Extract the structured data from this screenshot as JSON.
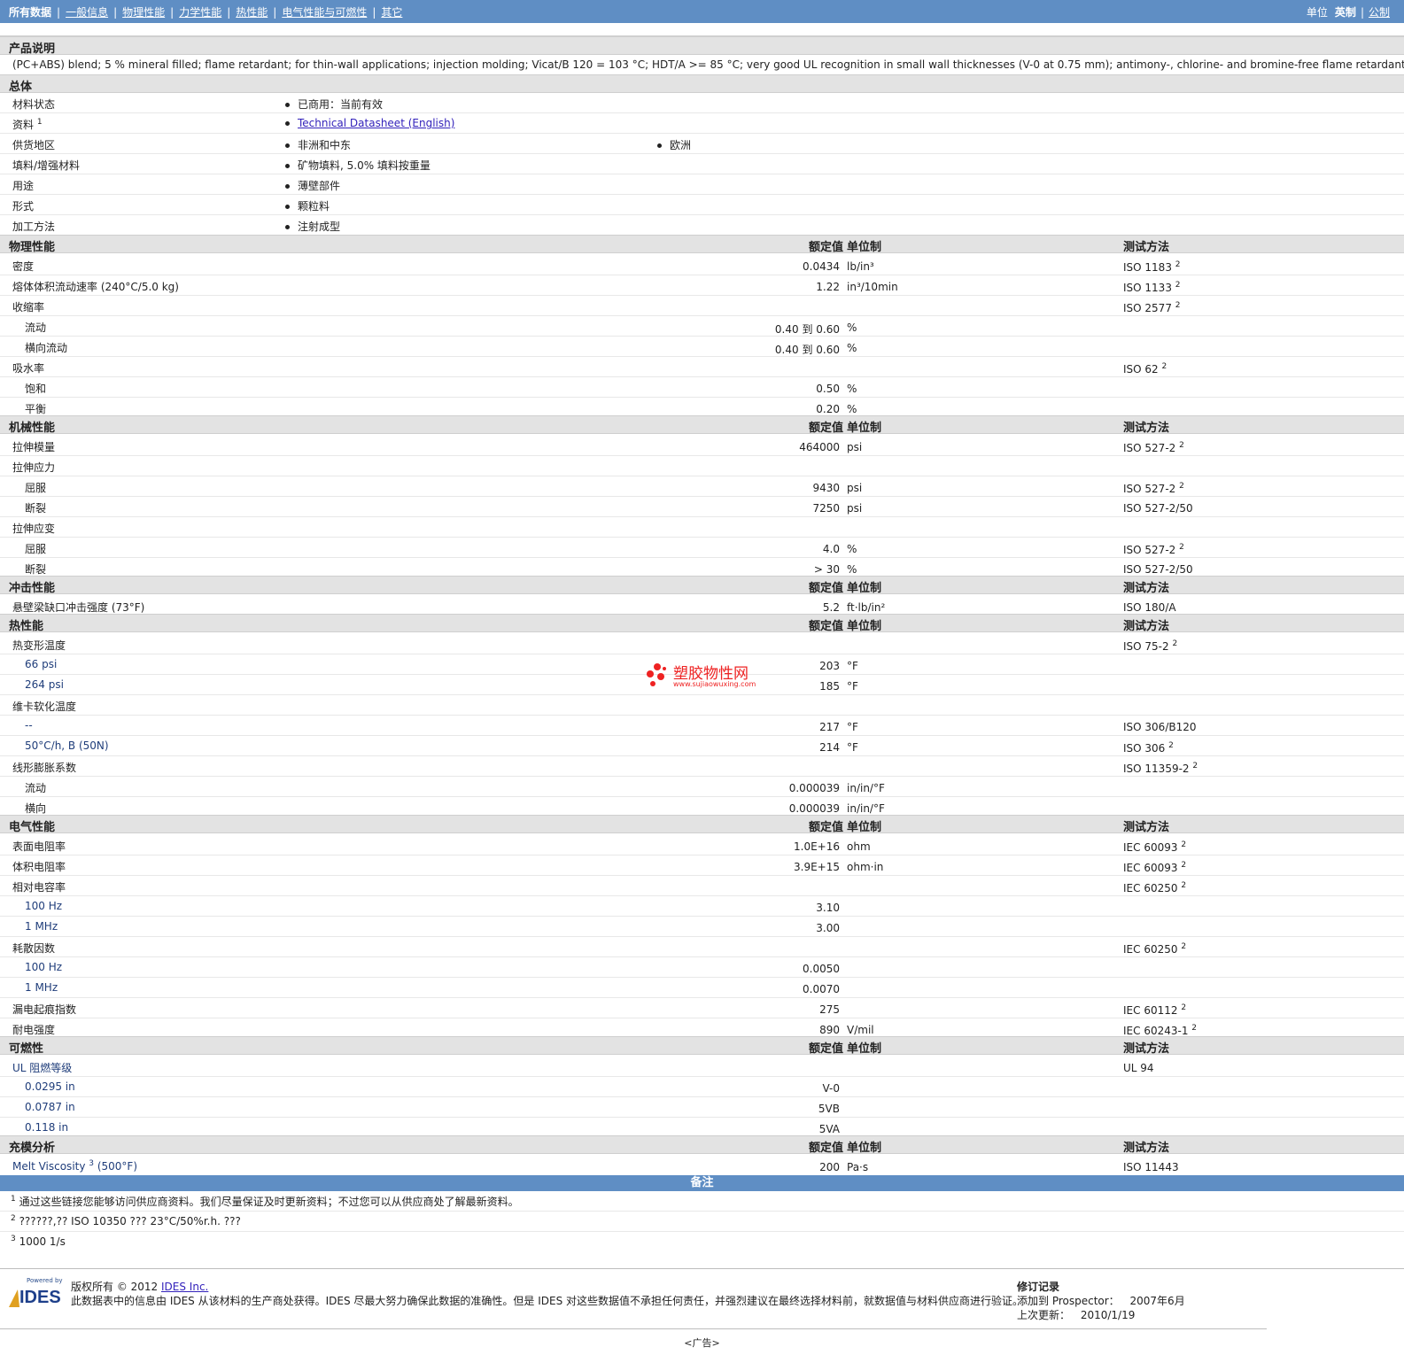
{
  "nav": {
    "items": [
      "所有数据",
      "一般信息",
      "物理性能",
      "力学性能",
      "热性能",
      "电气性能与可燃性",
      "其它"
    ],
    "units_label": "单位",
    "unit_english": "英制",
    "unit_metric": "公制"
  },
  "description": {
    "title": "产品说明",
    "text": "(PC+ABS) blend; 5 % mineral filled; flame retardant; for thin-wall applications; injection molding; Vicat/B 120 = 103 °C; HDT/A >= 85 °C; very good UL recognition in small wall thicknesses (V-0 at 0.75 mm); antimony-, chlorine- and bromine-free flame retardant."
  },
  "general": {
    "title": "总体",
    "rows": {
      "status": {
        "label": "材料状态",
        "value": "已商用：当前有效"
      },
      "docs": {
        "label": "资料",
        "sup": "1",
        "value": "Technical Datasheet (English)"
      },
      "region": {
        "label": "供货地区",
        "value1": "非洲和中东",
        "value2": "欧洲"
      },
      "filler": {
        "label": "填料/增强材料",
        "value": "矿物填料, 5.0% 填料按重量"
      },
      "use": {
        "label": "用途",
        "value": "薄壁部件"
      },
      "form": {
        "label": "形式",
        "value": "颗粒料"
      },
      "process": {
        "label": "加工方法",
        "value": "注射成型"
      }
    }
  },
  "headers": {
    "value": "额定值",
    "unit": "单位制",
    "method": "测试方法"
  },
  "physical": {
    "title": "物理性能",
    "rows": [
      {
        "label": "密度",
        "value": "0.0434",
        "unit": "lb/in³",
        "method": "ISO 1183",
        "sup": "2"
      },
      {
        "label": "熔体体积流动速率 (240°C/5.0 kg)",
        "value": "1.22",
        "unit": "in³/10min",
        "method": "ISO 1133",
        "sup": "2"
      },
      {
        "label": "收缩率",
        "value": "",
        "unit": "",
        "method": "ISO 2577",
        "sup": "2"
      },
      {
        "label": "流动",
        "value": "0.40 到  0.60",
        "unit": "%",
        "method": "",
        "sup": ""
      },
      {
        "label": "横向流动",
        "value": "0.40 到  0.60",
        "unit": "%",
        "method": "",
        "sup": ""
      },
      {
        "label": "吸水率",
        "value": "",
        "unit": "",
        "method": "ISO 62",
        "sup": "2"
      },
      {
        "label": "饱和",
        "value": "0.50",
        "unit": "%",
        "method": "",
        "sup": ""
      },
      {
        "label": "平衡",
        "value": "0.20",
        "unit": "%",
        "method": "",
        "sup": ""
      }
    ]
  },
  "mechanical": {
    "title": "机械性能",
    "rows": [
      {
        "label": "拉伸模量",
        "value": "464000",
        "unit": "psi",
        "method": "ISO 527-2",
        "sup": "2"
      },
      {
        "label": "拉伸应力",
        "value": "",
        "unit": "",
        "method": "",
        "sup": ""
      },
      {
        "label": "屈服",
        "value": "9430",
        "unit": "psi",
        "method": "ISO 527-2",
        "sup": "2"
      },
      {
        "label": "断裂",
        "value": "7250",
        "unit": "psi",
        "method": "ISO 527-2/50",
        "sup": ""
      },
      {
        "label": "拉伸应变",
        "value": "",
        "unit": "",
        "method": "",
        "sup": ""
      },
      {
        "label": "屈服",
        "value": "4.0",
        "unit": "%",
        "method": "ISO 527-2",
        "sup": "2"
      },
      {
        "label": "断裂",
        "value": "> 30",
        "unit": "%",
        "method": "ISO 527-2/50",
        "sup": ""
      }
    ]
  },
  "impact": {
    "title": "冲击性能",
    "rows": [
      {
        "label": "悬壁梁缺口冲击强度 (73°F)",
        "value": "5.2",
        "unit": "ft·lb/in²",
        "method": "ISO 180/A",
        "sup": ""
      }
    ]
  },
  "thermal": {
    "title": "热性能",
    "rows": [
      {
        "label": "热变形温度",
        "value": "",
        "unit": "",
        "method": "ISO 75-2",
        "sup": "2"
      },
      {
        "label": "66 psi",
        "value": "203",
        "unit": "°F",
        "method": "",
        "sup": ""
      },
      {
        "label": "264 psi",
        "value": "185",
        "unit": "°F",
        "method": "",
        "sup": ""
      },
      {
        "label": "维卡软化温度",
        "value": "",
        "unit": "",
        "method": "",
        "sup": ""
      },
      {
        "label": "--",
        "value": "217",
        "unit": "°F",
        "method": "ISO 306/B120",
        "sup": ""
      },
      {
        "label": "50°C/h, B (50N)",
        "value": "214",
        "unit": "°F",
        "method": "ISO 306",
        "sup": "2"
      },
      {
        "label": "线形膨胀系数",
        "value": "",
        "unit": "",
        "method": "ISO 11359-2",
        "sup": "2"
      },
      {
        "label": "流动",
        "value": "0.000039",
        "unit": "in/in/°F",
        "method": "",
        "sup": ""
      },
      {
        "label": "横向",
        "value": "0.000039",
        "unit": "in/in/°F",
        "method": "",
        "sup": ""
      }
    ]
  },
  "electrical": {
    "title": "电气性能",
    "rows": [
      {
        "label": "表面电阻率",
        "value": "1.0E+16",
        "unit": "ohm",
        "method": "IEC 60093",
        "sup": "2"
      },
      {
        "label": "体积电阻率",
        "value": "3.9E+15",
        "unit": "ohm·in",
        "method": "IEC 60093",
        "sup": "2"
      },
      {
        "label": "相对电容率",
        "value": "",
        "unit": "",
        "method": "IEC 60250",
        "sup": "2"
      },
      {
        "label": "100 Hz",
        "value": "3.10",
        "unit": "",
        "method": "",
        "sup": ""
      },
      {
        "label": "1 MHz",
        "value": "3.00",
        "unit": "",
        "method": "",
        "sup": ""
      },
      {
        "label": "耗散因数",
        "value": "",
        "unit": "",
        "method": "IEC 60250",
        "sup": "2"
      },
      {
        "label": "100 Hz",
        "value": "0.0050",
        "unit": "",
        "method": "",
        "sup": ""
      },
      {
        "label": "1 MHz",
        "value": "0.0070",
        "unit": "",
        "method": "",
        "sup": ""
      },
      {
        "label": "漏电起痕指数",
        "value": "275",
        "unit": "",
        "method": "IEC 60112",
        "sup": "2"
      },
      {
        "label": "耐电强度",
        "value": "890",
        "unit": "V/mil",
        "method": "IEC 60243-1",
        "sup": "2"
      }
    ]
  },
  "flammability": {
    "title": "可燃性",
    "rows": [
      {
        "label": "UL 阻燃等级",
        "value": "",
        "unit": "",
        "method": "UL 94",
        "sup": ""
      },
      {
        "label": "0.0295 in",
        "value": "V-0",
        "unit": "",
        "method": "",
        "sup": ""
      },
      {
        "label": "0.0787 in",
        "value": "5VB",
        "unit": "",
        "method": "",
        "sup": ""
      },
      {
        "label": "0.118 in",
        "value": "5VA",
        "unit": "",
        "method": "",
        "sup": ""
      }
    ]
  },
  "mold": {
    "title": "充模分析",
    "rows": [
      {
        "label": "Melt Viscosity",
        "label_sup": "3",
        "label_tail": " (500°F)",
        "value": "200",
        "unit": "Pa·s",
        "method": "ISO 11443",
        "sup": ""
      }
    ]
  },
  "notes": {
    "title": "备注",
    "items": [
      {
        "num": "1",
        "text": "通过这些链接您能够访问供应商资料。我们尽量保证及时更新资料；不过您可以从供应商处了解最新资料。"
      },
      {
        "num": "2",
        "text": "??????,?? ISO 10350 ??? 23°C/50%r.h. ???"
      },
      {
        "num": "3",
        "text": "1000 1/s"
      }
    ]
  },
  "footer": {
    "logo_small": "Powered by",
    "logo_text": "IDES",
    "copyright": "版权所有 © 2012",
    "company": "IDES Inc.",
    "disclaimer": "此数据表中的信息由 IDES 从该材料的生产商处获得。IDES 尽最大努力确保此数据的准确性。但是 IDES 对这些数据值不承担任何责任，并强烈建议在最终选择材料前，就数据值与材料供应商进行验证。",
    "rev_title": "修订记录",
    "rev_added_label": "添加到 Prospector：",
    "rev_added": "2007年6月",
    "rev_updated_label": "上次更新：",
    "rev_updated": "2010/1/19",
    "ad": "<广告>"
  },
  "watermark": {
    "text": "塑胶物性网",
    "url": "www.sujiaowuxing.com"
  },
  "colors": {
    "nav_bar": "#5f8ec4",
    "section_bg": "#e3e3e3",
    "link": "#3322bb",
    "watermark": "#ee2222"
  }
}
